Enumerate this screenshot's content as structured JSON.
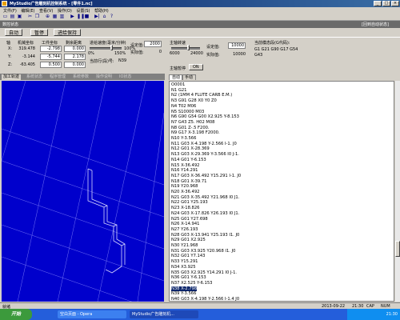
{
  "window": {
    "title": "MyStudio广告雕刻机控制系统 - [零件1.nc]",
    "minimize": "_",
    "maximize": "□",
    "close": "×"
  },
  "menu": [
    "文件(F)",
    "编辑(E)",
    "查看(V)",
    "操作(O)",
    "设置(S)",
    "帮助(H)"
  ],
  "status_strip": {
    "left": "数控状态",
    "right": "[回到自动状态]"
  },
  "modes": {
    "auto": "自动",
    "pause": "暂停",
    "advance_hold": "进给保持"
  },
  "coords": {
    "header_axis": "轴",
    "header_machine": "机械坐标",
    "header_work": "工件坐标",
    "header_remaining": "剩余距离",
    "rows": [
      {
        "axis": "X:",
        "machine": "319.478",
        "work": "-2.798",
        "remaining": "0.000"
      },
      {
        "axis": "Y:",
        "machine": "-3.144",
        "work": "-5.744",
        "remaining": "2.178"
      },
      {
        "axis": "Z:",
        "machine": "-63.405",
        "work": "0.500",
        "remaining": "0.000"
      }
    ]
  },
  "feed": {
    "title": "进给速度(毫米/分钟)",
    "set_label": "设定值:",
    "set_value": "2000",
    "actual_label": "实际值:",
    "actual_value": "0",
    "percent": "100%",
    "scale_min": "0%",
    "scale_max": "150%",
    "current_line_label": "当前行(段)号:",
    "current_line": "N39"
  },
  "spindle": {
    "title": "主轴转速",
    "set_label": "设定值:",
    "set_value": "10000",
    "actual_label": "实际值:",
    "actual_value": "10000",
    "scale_min": "6000",
    "scale_max": "24000",
    "run_label": "主轴暂停",
    "state": "ON"
  },
  "gcode_state": {
    "title": "当前模态段(G代码):",
    "line1": "G1 G21 G90 G17 G54",
    "line2": "G43"
  },
  "left_tabs": [
    "加工轨迹",
    "系统状态",
    "程序管理",
    "系统参数",
    "操作说明",
    "IO状态"
  ],
  "right_tabs": [
    "自动",
    "手动"
  ],
  "code_lines": [
    "O0001",
    "N1 G21",
    "N2 (1MM 4 FLUTE CARB E.M.)",
    "N3 G91 G28 X0 Y0 Z0",
    "N4 T02 M06",
    "N5 S10000 M03",
    "N6 G90 G54 G00 X2.925 Y-8.153",
    "N7 G43 Z5. H02 M08",
    "N8 G01 Z-.5 F200.",
    "N9 G17 X-3.198 F2000.",
    "N10 Y-3.566",
    "N11 G03 X-4.198 Y-2.566 I-1. J0",
    "N12 G01 X-28.369",
    "N13 G03 X-29.369 Y-3.566 I0 J-1.",
    "N14 G01 Y-6.153",
    "N15 X-36.492",
    "N16 Y14.291",
    "N17 G03 X-36.492 Y15.291 I-1. J0",
    "N18 G01 X-39.71",
    "N19 Y20.968",
    "N20 X-36.492",
    "N21 G03 X-35.492 Y21.968 I0 J1.",
    "N22 G01 Y25.193",
    "N23 X-18.826",
    "N24 G03 X-17.826 Y26.193 I0 J1.",
    "N25 G01 Y27.698",
    "N26 X-14.941",
    "N27 Y26.193",
    "N28 G03 X-13.941 Y25.193 I1. J0",
    "N29 G01 X2.925",
    "N30 Y21.968",
    "N31 G03 X3.925 Y20.968 I1. J0",
    "N32 G01 Y7.143",
    "N33 Y15.291",
    "N34 X3.925",
    "N35 G03 X2.925 Y14.291 I0 J-1.",
    "N36 G01 Y-6.153",
    "N37 X2.525 Y-6.153",
    "N38 X-2.798",
    "N39 Y-3.566",
    "N40 G03 X-4.198 Y-2.566 I-1.4 J0"
  ],
  "selected_line_index": 38,
  "statusbar": {
    "left": "就绪",
    "date": "2013-09-22",
    "time": "21:30",
    "caps": "CAP",
    "num": "NUM"
  },
  "taskbar": {
    "start": "开始",
    "tasks": [
      "空白页面 - Opera",
      "MyStudio广告雕刻机..."
    ],
    "clock": "21:30"
  },
  "colors": {
    "viewport": "#0000cc",
    "toolpath": "#d8d8ff",
    "selection": "#0a246a",
    "taskbar": "#245edb"
  }
}
